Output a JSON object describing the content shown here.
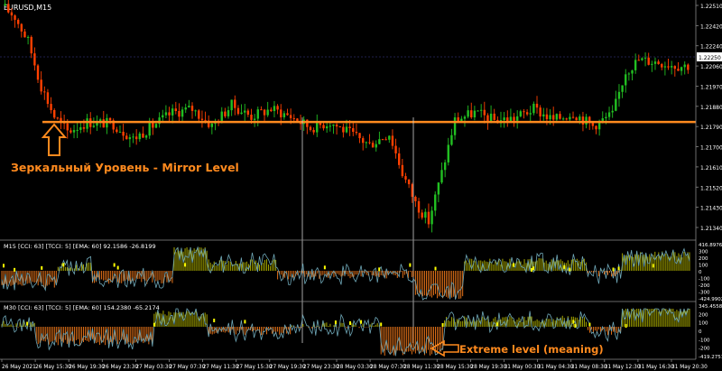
{
  "window": {
    "symbol": "EURUSD,M15"
  },
  "colors": {
    "background": "#000000",
    "bull": "#22c022",
    "bear": "#ff4000",
    "mirror_line": "#ff8a1e",
    "annotation": "#ff8a1e",
    "axis_text": "#ffffff",
    "cci_line": "#6fa8b8",
    "hist_up": "#a7a800",
    "hist_down": "#e07018",
    "signal_dots": "#ffff00"
  },
  "price_axis": {
    "labels": [
      "1.22510",
      "1.22420",
      "1.22240",
      "1.22060",
      "1.21970",
      "1.21880",
      "1.21790",
      "1.21700",
      "1.21610",
      "1.21520",
      "1.21430",
      "1.21340"
    ],
    "current_price": "1.22250",
    "current_price_marker_label": "1.22250"
  },
  "panel1": {
    "header": "M15 [CCI: 63] [TCCI: 5] [EMA: 60] 92.1586 -26.8199",
    "axis_labels": [
      "416.8976",
      "300",
      "200",
      "100",
      "0",
      "-100",
      "-200",
      "-300",
      "-424.9902"
    ]
  },
  "panel2": {
    "header": "M30 [CCI: 63] [TCCI: 5] [EMA: 60] 154.2380 -65.2174",
    "axis_labels": [
      "345.4558",
      "200",
      "100",
      "0",
      "-100",
      "-200",
      "-419.2751"
    ]
  },
  "time_axis": {
    "labels": [
      "26 May 2021",
      "26 May 15:30",
      "26 May 19:30",
      "26 May 23:30",
      "27 May 03:30",
      "27 May 07:30",
      "27 May 11:30",
      "27 May 15:30",
      "27 May 19:30",
      "27 May 23:30",
      "28 May 03:30",
      "28 May 07:30",
      "28 May 11:30",
      "28 May 15:30",
      "28 May 19:30",
      "31 May 00:30",
      "31 May 04:30",
      "31 May 08:30",
      "31 May 12:30",
      "31 May 16:30",
      "31 May 20:30"
    ]
  },
  "annotations": {
    "mirror_level": "Зеркальный Уровень - Mirror Level",
    "extreme_level": "Extreme level (meaning)"
  },
  "chart_data": {
    "type": "candlestick",
    "title": "EURUSD,M15",
    "mirror_level_price": 1.2193,
    "ylim": [
      1.2134,
      1.2256
    ],
    "close_path": [
      [
        0,
        1.2255
      ],
      [
        4,
        1.2249
      ],
      [
        8,
        1.2236
      ],
      [
        12,
        1.2212
      ],
      [
        16,
        1.2196
      ],
      [
        20,
        1.2188
      ],
      [
        26,
        1.2193
      ],
      [
        34,
        1.2192
      ],
      [
        40,
        1.2184
      ],
      [
        46,
        1.2191
      ],
      [
        52,
        1.2198
      ],
      [
        58,
        1.22
      ],
      [
        64,
        1.2191
      ],
      [
        70,
        1.2202
      ],
      [
        76,
        1.2196
      ],
      [
        82,
        1.22
      ],
      [
        88,
        1.2196
      ],
      [
        94,
        1.219
      ],
      [
        100,
        1.2193
      ],
      [
        106,
        1.2187
      ],
      [
        112,
        1.2181
      ],
      [
        118,
        1.2187
      ],
      [
        122,
        1.2166
      ],
      [
        126,
        1.215
      ],
      [
        130,
        1.214
      ],
      [
        134,
        1.2166
      ],
      [
        138,
        1.2194
      ],
      [
        144,
        1.2198
      ],
      [
        150,
        1.2194
      ],
      [
        156,
        1.2195
      ],
      [
        162,
        1.22
      ],
      [
        168,
        1.2194
      ],
      [
        174,
        1.2198
      ],
      [
        180,
        1.2191
      ],
      [
        186,
        1.2197
      ],
      [
        190,
        1.222
      ],
      [
        194,
        1.2226
      ],
      [
        200,
        1.2225
      ],
      [
        206,
        1.2223
      ]
    ]
  }
}
